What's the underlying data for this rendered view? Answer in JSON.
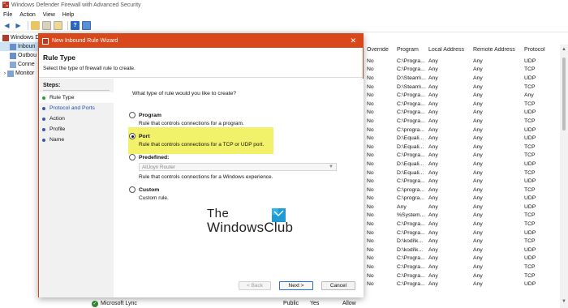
{
  "window": {
    "title": "Windows Defender Firewall with Advanced Security"
  },
  "menu": [
    "File",
    "Action",
    "View",
    "Help"
  ],
  "tree": {
    "items": [
      {
        "label": "Windows De"
      },
      {
        "label": "Inboun"
      },
      {
        "label": "Outbou"
      },
      {
        "label": "Conne"
      },
      {
        "label": "Monitor"
      }
    ]
  },
  "grid": {
    "columns": [
      "Override",
      "Program",
      "Local Address",
      "Remote Address",
      "Protocol"
    ],
    "rows": [
      [
        "No",
        "C:\\Progra...",
        "Any",
        "Any",
        "UDP"
      ],
      [
        "No",
        "C:\\Progra...",
        "Any",
        "Any",
        "TCP"
      ],
      [
        "No",
        "D:\\Steam\\...",
        "Any",
        "Any",
        "UDP"
      ],
      [
        "No",
        "D:\\Steam\\...",
        "Any",
        "Any",
        "TCP"
      ],
      [
        "No",
        "C:\\Progra...",
        "Any",
        "Any",
        "Any"
      ],
      [
        "No",
        "C:\\Progra...",
        "Any",
        "Any",
        "TCP"
      ],
      [
        "No",
        "C:\\Progra...",
        "Any",
        "Any",
        "UDP"
      ],
      [
        "No",
        "C:\\Progra...",
        "Any",
        "Any",
        "TCP"
      ],
      [
        "No",
        "C:\\progra...",
        "Any",
        "Any",
        "UDP"
      ],
      [
        "No",
        "D:\\Equali...",
        "Any",
        "Any",
        "UDP"
      ],
      [
        "No",
        "D:\\Equali...",
        "Any",
        "Any",
        "TCP"
      ],
      [
        "No",
        "C:\\Progra...",
        "Any",
        "Any",
        "TCP"
      ],
      [
        "No",
        "D:\\Equali...",
        "Any",
        "Any",
        "UDP"
      ],
      [
        "No",
        "D:\\Equali...",
        "Any",
        "Any",
        "TCP"
      ],
      [
        "No",
        "C:\\Progra...",
        "Any",
        "Any",
        "UDP"
      ],
      [
        "No",
        "C:\\progra...",
        "Any",
        "Any",
        "TCP"
      ],
      [
        "No",
        "C:\\progra...",
        "Any",
        "Any",
        "UDP"
      ],
      [
        "No",
        "Any",
        "Any",
        "Any",
        "UDP"
      ],
      [
        "No",
        "%System...",
        "Any",
        "Any",
        "TCP"
      ],
      [
        "No",
        "C:\\Progra...",
        "Any",
        "Any",
        "TCP"
      ],
      [
        "No",
        "C:\\Progra...",
        "Any",
        "Any",
        "UDP"
      ],
      [
        "No",
        "D:\\kodi\\k...",
        "Any",
        "Any",
        "TCP"
      ],
      [
        "No",
        "D:\\kodi\\k...",
        "Any",
        "Any",
        "UDP"
      ],
      [
        "No",
        "C:\\Progra...",
        "Any",
        "Any",
        "UDP"
      ],
      [
        "No",
        "C:\\Progra...",
        "Any",
        "Any",
        "TCP"
      ],
      [
        "No",
        "C:\\Progra...",
        "Any",
        "Any",
        "TCP"
      ],
      [
        "No",
        "C:\\Progra...",
        "Any",
        "Any",
        "UDP"
      ]
    ],
    "bottom_row": {
      "name": "Microsoft Lync",
      "profile": "Public",
      "enabled": "Yes",
      "action": "Allow"
    }
  },
  "wizard": {
    "title": "New Inbound Rule Wizard",
    "heading": "Rule Type",
    "subheading": "Select the type of firewall rule to create.",
    "steps_title": "Steps:",
    "steps": [
      "Rule Type",
      "Protocol and Ports",
      "Action",
      "Profile",
      "Name"
    ],
    "question": "What type of rule would you like to create?",
    "options": [
      {
        "label": "Program",
        "desc": "Rule that controls connections for a program."
      },
      {
        "label": "Port",
        "desc": "Rule that controls connections for a TCP or UDP port."
      },
      {
        "label": "Predefined:",
        "desc": "Rule that controls connections for a Windows experience."
      },
      {
        "label": "Custom",
        "desc": "Custom rule."
      }
    ],
    "predefined_value": "AllJoyn Router",
    "buttons": {
      "back": "< Back",
      "next": "Next >",
      "cancel": "Cancel"
    }
  },
  "watermark": {
    "line1": "The",
    "line2": "WindowsClub"
  },
  "colors": {
    "wizard_title_bg": "#d9481b",
    "highlight": "#f1ef5a",
    "selection": "#cde4f7"
  }
}
